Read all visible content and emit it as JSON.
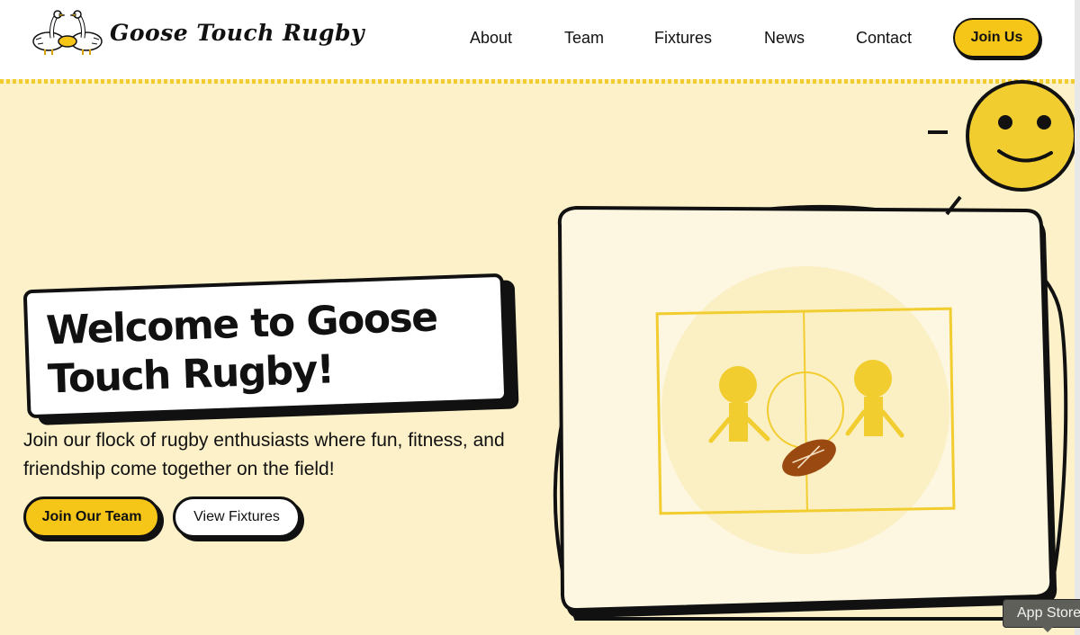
{
  "brand": {
    "name": "Goose Touch Rugby",
    "logo_caption": "Goose",
    "logo_ball_text": "TOUCH"
  },
  "nav": {
    "items": [
      {
        "label": "About"
      },
      {
        "label": "Team"
      },
      {
        "label": "Fixtures"
      },
      {
        "label": "News"
      },
      {
        "label": "Contact"
      }
    ],
    "cta_label": "Join Us"
  },
  "hero": {
    "title": "Welcome to Goose Touch Rugby!",
    "subtitle": "Join our flock of rugby enthusiasts where fun, fitness, and friendship come together on the field!",
    "primary_button": "Join Our Team",
    "secondary_button": "View Fixtures"
  },
  "tooltip": {
    "label": "App Store"
  },
  "colors": {
    "accent": "#f5c518",
    "background": "#fcf1c9",
    "ball": "#9a4a10"
  },
  "icons": [
    "goose-logo-icon",
    "smiley-face-icon",
    "rugby-pitch-illustration",
    "player-icon",
    "rugby-ball-icon"
  ]
}
